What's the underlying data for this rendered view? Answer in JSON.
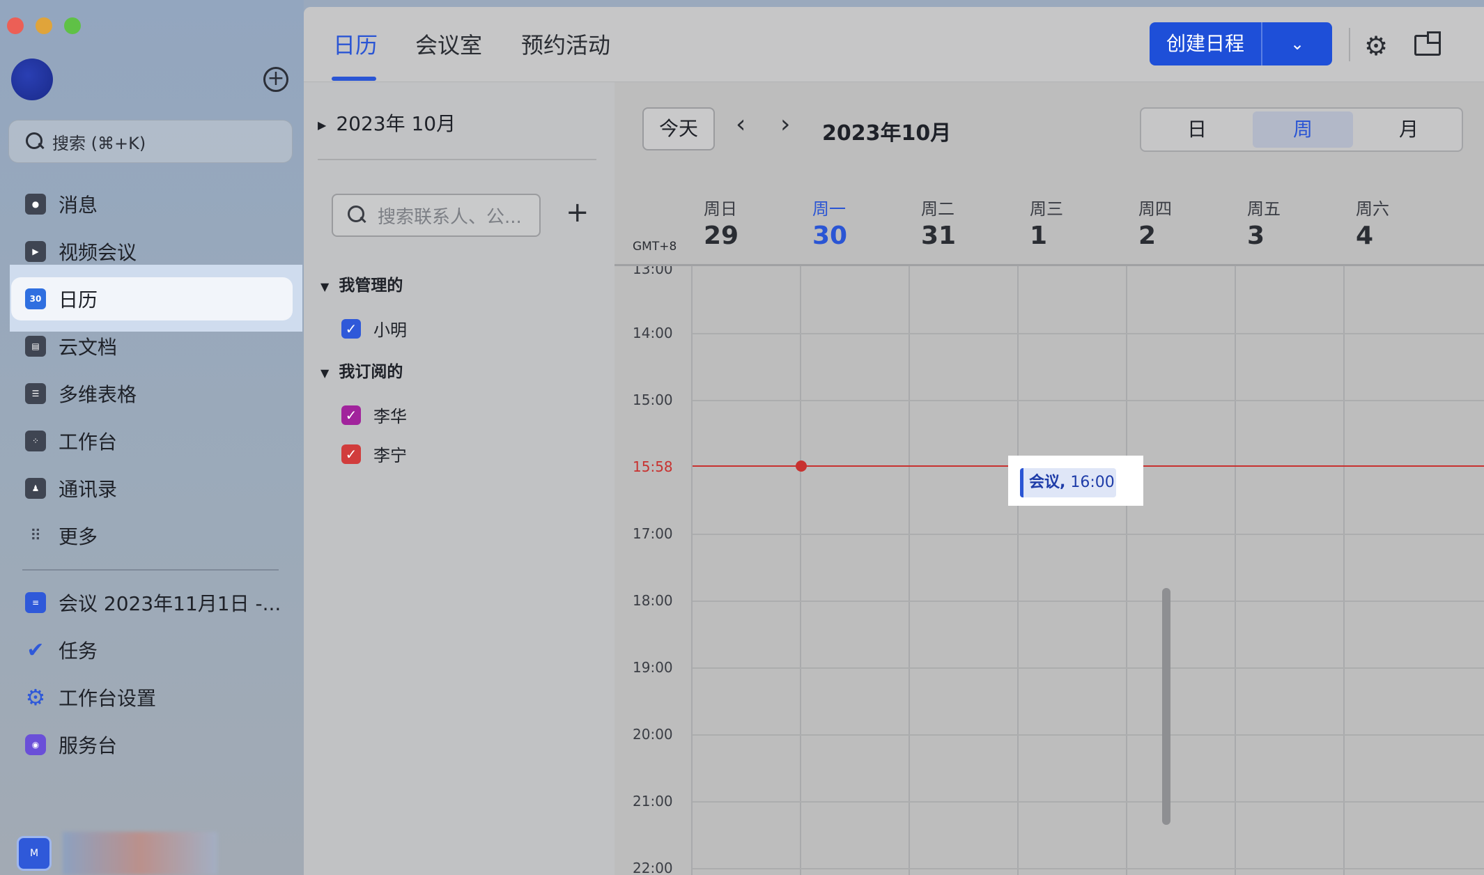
{
  "sidebar": {
    "search_placeholder": "搜索 (⌘+K)",
    "items": [
      {
        "label": "消息",
        "icon": "chat-bubble-icon"
      },
      {
        "label": "视频会议",
        "icon": "video-camera-icon"
      },
      {
        "label": "日历",
        "icon": "calendar-icon",
        "icon_text": "30",
        "active": true
      },
      {
        "label": "云文档",
        "icon": "document-icon"
      },
      {
        "label": "多维表格",
        "icon": "table-icon"
      },
      {
        "label": "工作台",
        "icon": "apps-grid-icon"
      },
      {
        "label": "通讯录",
        "icon": "contacts-icon"
      },
      {
        "label": "更多",
        "icon": "more-dots-icon"
      },
      {
        "label": "会议 2023年11月1日 -...",
        "icon": "doc-blue-icon"
      },
      {
        "label": "任务",
        "icon": "task-check-icon"
      },
      {
        "label": "工作台设置",
        "icon": "settings-gear-icon"
      },
      {
        "label": "服务台",
        "icon": "service-desk-icon"
      }
    ],
    "bottom_app_label": "M"
  },
  "topbar": {
    "tabs": [
      "日历",
      "会议室",
      "预约活动"
    ],
    "create_label": "创建日程"
  },
  "leftcol": {
    "month": "2023年 10月",
    "contact_search_placeholder": "搜索联系人、公...",
    "groups": [
      {
        "title": "我管理的",
        "calendars": [
          {
            "name": "小明",
            "color": "#2f59d9"
          }
        ]
      },
      {
        "title": "我订阅的",
        "calendars": [
          {
            "name": "李华",
            "color": "#a1239c"
          },
          {
            "name": "李宁",
            "color": "#d13c3c"
          }
        ]
      }
    ]
  },
  "calendar": {
    "today_label": "今天",
    "title": "2023年10月",
    "views": [
      "日",
      "周",
      "月"
    ],
    "active_view": "周",
    "timezone": "GMT+8",
    "days": [
      {
        "name": "周日",
        "date": "29"
      },
      {
        "name": "周一",
        "date": "30",
        "today": true
      },
      {
        "name": "周二",
        "date": "31"
      },
      {
        "name": "周三",
        "date": "1"
      },
      {
        "name": "周四",
        "date": "2"
      },
      {
        "name": "周五",
        "date": "3"
      },
      {
        "name": "周六",
        "date": "4"
      }
    ],
    "hours": [
      "13:00",
      "14:00",
      "15:00",
      "17:00",
      "18:00",
      "19:00",
      "20:00",
      "21:00",
      "22:00"
    ],
    "now_label": "15:58",
    "event": {
      "title": "会议,",
      "time": "16:00"
    }
  },
  "colors": {
    "accent": "#2a55d4",
    "now": "#c8312f"
  }
}
